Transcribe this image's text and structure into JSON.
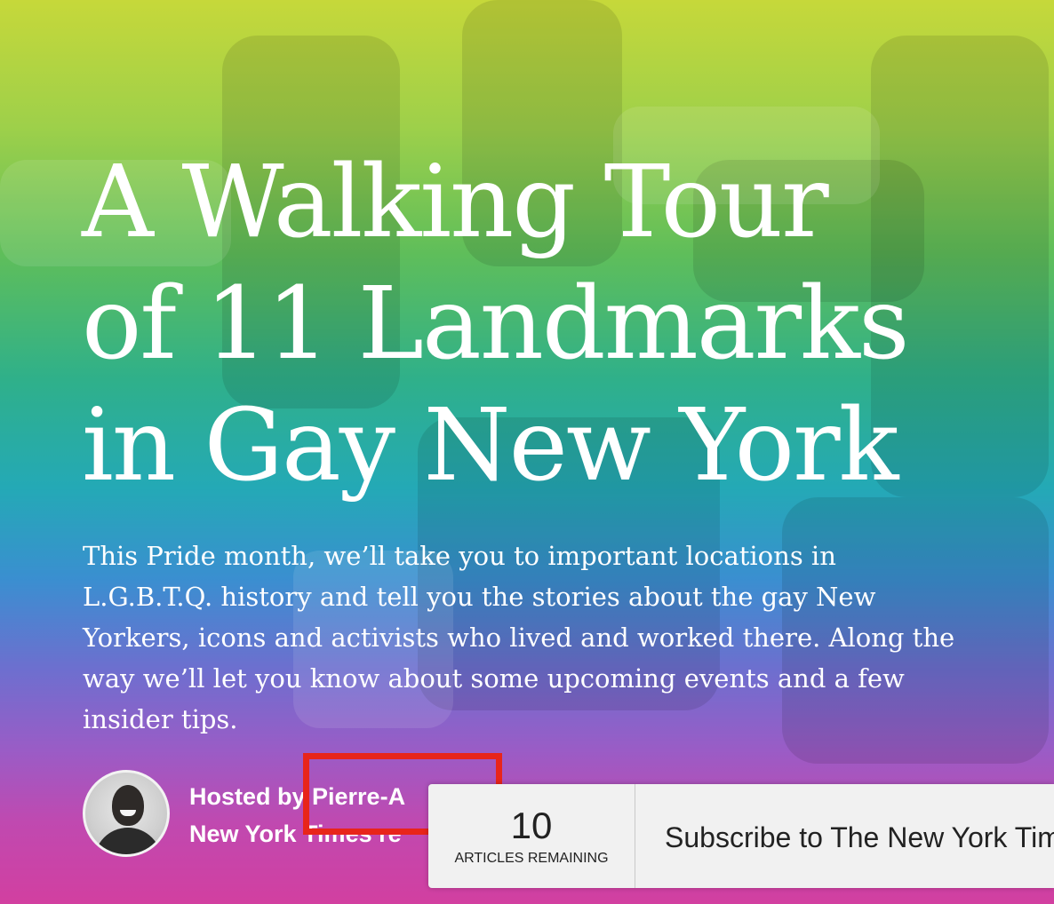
{
  "hero": {
    "headline_lines": [
      "A Walking Tour",
      "of 11 Landmarks",
      "in Gay New York"
    ],
    "dek_lines": [
      "This Pride month, we’ll take you to important locations in",
      "L.G.B.T.Q. history and tell you the stories about the gay New",
      "Yorkers, icons and activists who lived and worked there. Along the",
      "way we’ll let you know about some upcoming events and a few",
      "insider tips."
    ]
  },
  "byline": {
    "line1": "Hosted by  Pierre-A",
    "line2": "New York Times re"
  },
  "meter": {
    "count": "10",
    "label": "ARTICLES REMAINING"
  },
  "subscribe": {
    "text": "Subscribe to The New York Times"
  },
  "colors": {
    "highlight": "#e8251a",
    "text": "#ffffff"
  }
}
